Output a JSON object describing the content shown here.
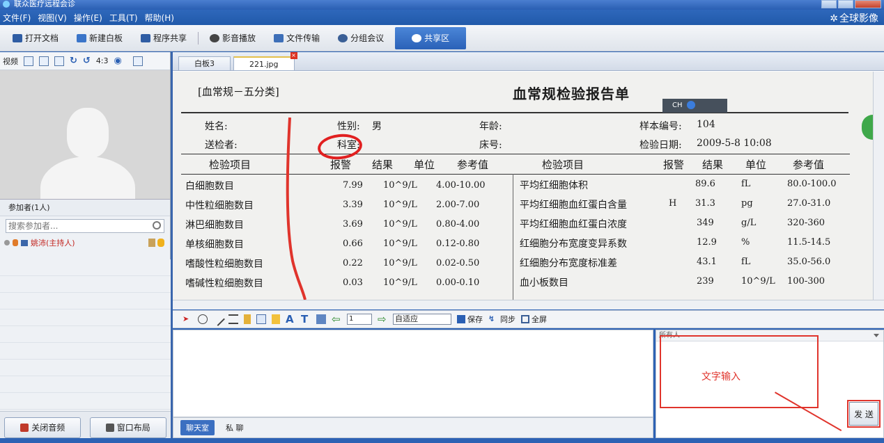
{
  "window": {
    "title": "联众医疗远程会诊"
  },
  "menu": [
    "文件(F)",
    "视图(V)",
    "操作(E)",
    "工具(T)",
    "帮助(H)"
  ],
  "brand": "全球影像",
  "toolbar": {
    "items": [
      "打开文档",
      "新建白板",
      "程序共享",
      "影音播放",
      "文件传输",
      "分组会议",
      "共享区"
    ]
  },
  "video": {
    "label": "视频",
    "ratio": "4:3"
  },
  "participants": {
    "header": "参加者(1人)",
    "search_placeholder": "搜索参加者...",
    "list": [
      {
        "name": "姚沛(主持人)"
      }
    ]
  },
  "bottom_buttons": {
    "audio": "关闭音频",
    "layout": "窗口布局"
  },
  "doc_tabs": [
    "白板3",
    "221.jpg"
  ],
  "report": {
    "category": "[血常规－五分类]",
    "title": "血常规检验报告单",
    "ime": "CH",
    "fields": {
      "name_label": "姓名:",
      "gender_label": "性别:",
      "gender_value": "男",
      "age_label": "年龄:",
      "sample_label": "样本编号:",
      "sample_value": "104",
      "sender_label": "送检者:",
      "dept_label": "科室:",
      "bed_label": "床号:",
      "date_label": "检验日期:",
      "date_value": "2009-5-8 10:08"
    },
    "headers_left": [
      "检验项目",
      "报警",
      "结果",
      "单位",
      "参考值"
    ],
    "headers_right": [
      "检验项目",
      "报警",
      "结果",
      "单位",
      "参考值"
    ],
    "rows_left": [
      {
        "item": "白细胞数目",
        "result": "7.99",
        "unit": "10^9/L",
        "ref": "4.00-10.00"
      },
      {
        "item": "中性粒细胞数目",
        "result": "3.39",
        "unit": "10^9/L",
        "ref": "2.00-7.00"
      },
      {
        "item": "淋巴细胞数目",
        "result": "3.69",
        "unit": "10^9/L",
        "ref": "0.80-4.00"
      },
      {
        "item": "单核细胞数目",
        "result": "0.66",
        "unit": "10^9/L",
        "ref": "0.12-0.80"
      },
      {
        "item": "嗜酸性粒细胞数目",
        "result": "0.22",
        "unit": "10^9/L",
        "ref": "0.02-0.50"
      },
      {
        "item": "嗜碱性粒细胞数目",
        "result": "0.03",
        "unit": "10^9/L",
        "ref": "0.00-0.10"
      }
    ],
    "rows_right": [
      {
        "item": "平均红细胞体积",
        "flag": "",
        "result": "89.6",
        "unit": "fL",
        "ref": "80.0-100.0"
      },
      {
        "item": "平均红细胞血红蛋白含量",
        "flag": "H",
        "result": "31.3",
        "unit": "pg",
        "ref": "27.0-31.0"
      },
      {
        "item": "平均红细胞血红蛋白浓度",
        "flag": "",
        "result": "349",
        "unit": "g/L",
        "ref": "320-360"
      },
      {
        "item": "红细胞分布宽度变异系数",
        "flag": "",
        "result": "12.9",
        "unit": "%",
        "ref": "11.5-14.5"
      },
      {
        "item": "红细胞分布宽度标准差",
        "flag": "",
        "result": "43.1",
        "unit": "fL",
        "ref": "35.0-56.0"
      },
      {
        "item": "血小板数目",
        "flag": "",
        "result": "239",
        "unit": "10^9/L",
        "ref": "100-300"
      }
    ]
  },
  "draw_toolbar": {
    "page": "1",
    "zoom": "自适应",
    "save": "保存",
    "sync": "同步",
    "fullscreen": "全屏"
  },
  "chat": {
    "tabs": [
      "聊天室",
      "私 聊"
    ],
    "recipient": "所有人",
    "input_hint": "文字输入",
    "send": "发 送"
  },
  "colors": {
    "accent": "#2d62b4",
    "annotation": "#e0342c"
  }
}
